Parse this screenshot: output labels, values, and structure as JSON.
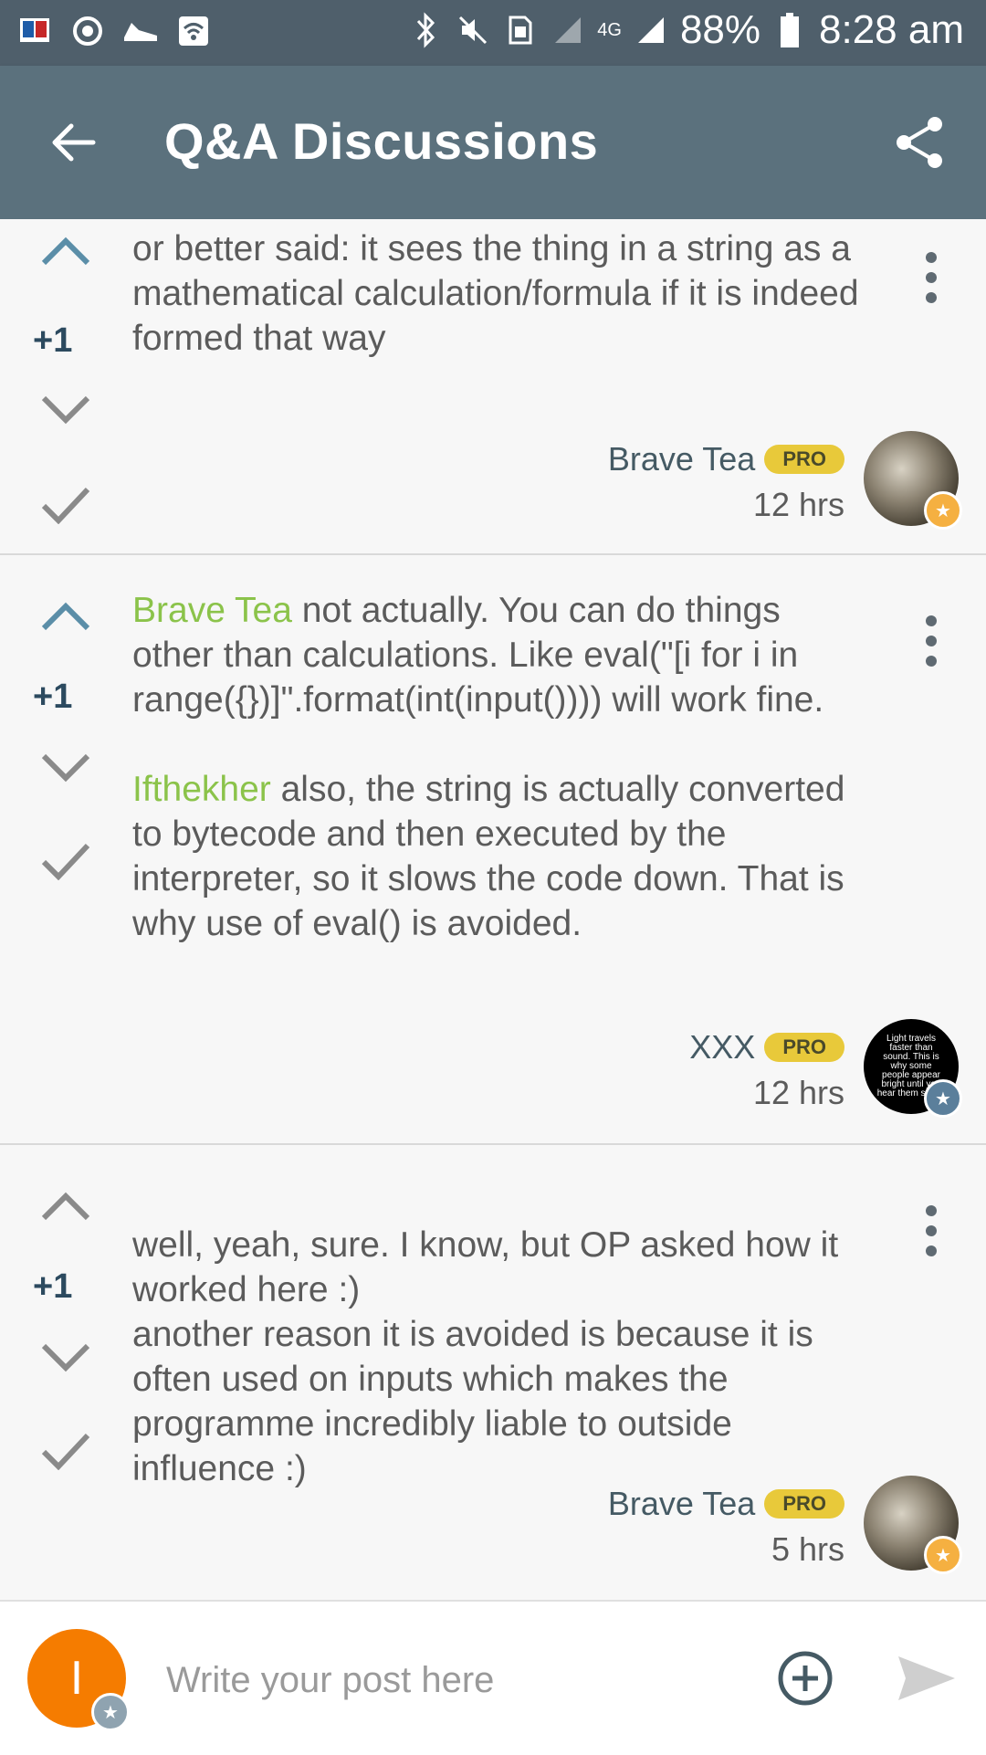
{
  "status_bar": {
    "battery": "88%",
    "time": "8:28 am",
    "network": "4G"
  },
  "app_bar": {
    "title": "Q&A Discussions"
  },
  "posts": [
    {
      "votes": "+1",
      "paragraphs": [
        {
          "mention": "",
          "text": "or better said: it sees the thing in a string as a mathematical calculation/formula if it is indeed formed that way"
        }
      ],
      "author": "Brave Tea",
      "badge": "PRO",
      "time": "12 hrs"
    },
    {
      "votes": "+1",
      "paragraphs": [
        {
          "mention": "Brave Tea",
          "text": " not actually. You can do things other than calculations. Like eval(\"[i for i in range({})]\".format(int(input()))) will work fine."
        },
        {
          "mention": "Ifthekher",
          "text": " also, the string is actually converted to bytecode and then executed by the interpreter, so it slows the code down. That is why use of eval() is avoided."
        }
      ],
      "author": "XXX",
      "badge": "PRO",
      "time": "12 hrs",
      "avatar_text": "Light travels faster than sound. This is why some people appear bright until you hear them speak"
    },
    {
      "votes": "+1",
      "paragraphs": [
        {
          "mention": "",
          "text": "well, yeah, sure. I know, but OP asked how it worked here :)\nanother reason it is avoided is because it is often used on inputs which makes the programme incredibly liable to outside influence :)"
        }
      ],
      "author": "Brave Tea",
      "badge": "PRO",
      "time": "5 hrs"
    }
  ],
  "composer": {
    "avatar_letter": "I",
    "placeholder": "Write your post here"
  },
  "colors": {
    "status_bar": "#4f5f6b",
    "app_bar": "#5b717d",
    "mention": "#8bc34a",
    "pro_badge": "#e8c93a",
    "vote_up_active": "#5b8ea8",
    "user_avatar": "#f57c00"
  },
  "icons": {
    "back": "arrow-left-icon",
    "share": "share-icon",
    "upvote": "chevron-up-icon",
    "downvote": "chevron-down-icon",
    "accept": "checkmark-icon",
    "menu": "more-vertical-icon",
    "attach": "plus-circle-icon",
    "send": "send-icon"
  }
}
